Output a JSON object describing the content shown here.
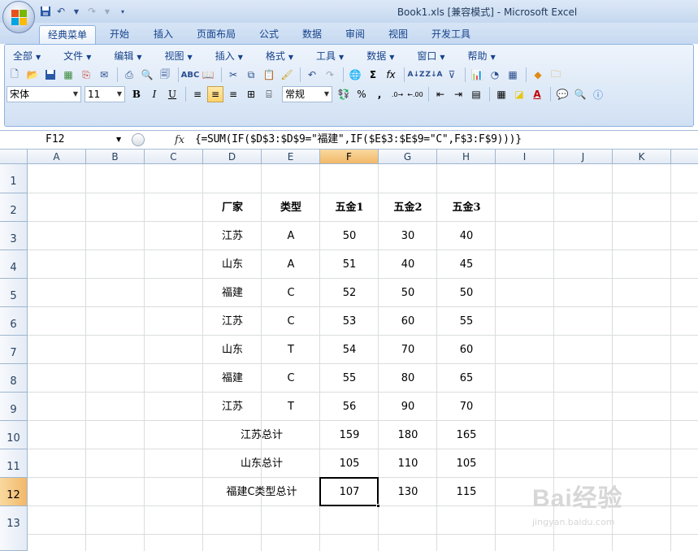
{
  "window": {
    "title": "Book1.xls  [兼容模式] - Microsoft Excel"
  },
  "ribbon_tabs": [
    "经典菜单",
    "开始",
    "插入",
    "页面布局",
    "公式",
    "数据",
    "审阅",
    "视图",
    "开发工具"
  ],
  "classic_menu": [
    "全部",
    "文件",
    "编辑",
    "视图",
    "插入",
    "格式",
    "工具",
    "数据",
    "窗口",
    "帮助"
  ],
  "format_bar": {
    "font": "宋体",
    "size": "11",
    "number_format": "常规"
  },
  "formula_bar": {
    "name_box": "F12",
    "fx_label": "fx",
    "formula": "{=SUM(IF($D$3:$D$9=\"福建\",IF($E$3:$E$9=\"C\",F$3:F$9)))}"
  },
  "columns": [
    "A",
    "B",
    "C",
    "D",
    "E",
    "F",
    "G",
    "H",
    "I",
    "J",
    "K"
  ],
  "selected_column": "F",
  "rows": [
    "1",
    "2",
    "3",
    "4",
    "5",
    "6",
    "7",
    "8",
    "9",
    "10",
    "11",
    "12",
    "13"
  ],
  "selected_row": "12",
  "table": {
    "headers": [
      "厂家",
      "类型",
      "五金1",
      "五金2",
      "五金3"
    ],
    "data": [
      [
        "江苏",
        "A",
        "50",
        "30",
        "40"
      ],
      [
        "山东",
        "A",
        "51",
        "40",
        "45"
      ],
      [
        "福建",
        "C",
        "52",
        "50",
        "50"
      ],
      [
        "江苏",
        "C",
        "53",
        "60",
        "55"
      ],
      [
        "山东",
        "T",
        "54",
        "70",
        "60"
      ],
      [
        "福建",
        "C",
        "55",
        "80",
        "65"
      ],
      [
        "江苏",
        "T",
        "56",
        "90",
        "70"
      ]
    ],
    "totals": [
      [
        "江苏总计",
        "159",
        "180",
        "165"
      ],
      [
        "山东总计",
        "105",
        "110",
        "105"
      ],
      [
        "福建C类型总计",
        "107",
        "130",
        "115"
      ]
    ]
  },
  "watermark": {
    "brand": "Bai经验",
    "url": "jingyan.baidu.com"
  }
}
